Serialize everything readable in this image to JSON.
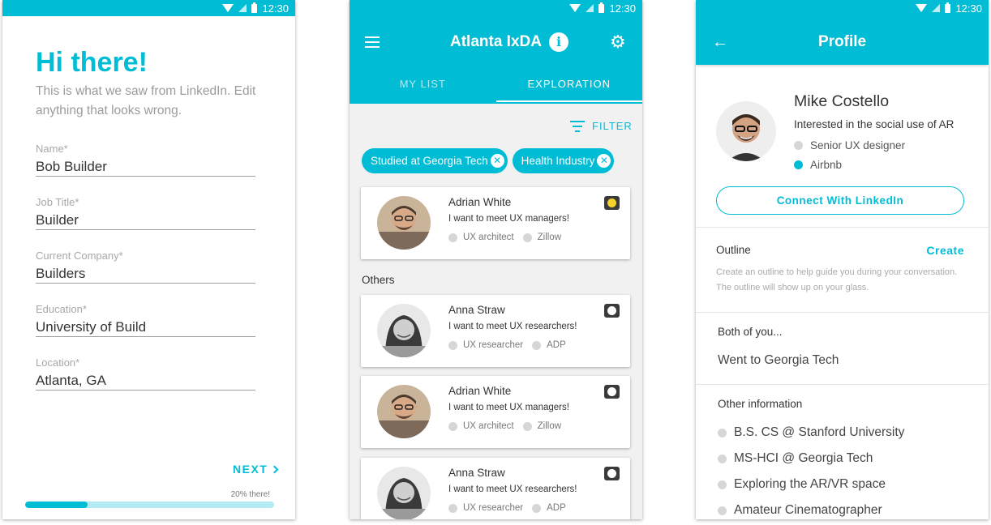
{
  "status": {
    "time": "12:30"
  },
  "colors": {
    "accent": "#00bcd4",
    "status_yellow": "#f7d22a",
    "dot_gray": "#d6d6d6"
  },
  "onboarding": {
    "title": "Hi there!",
    "subtitle": "This is what we saw from LinkedIn. Edit anything that looks wrong.",
    "fields": [
      {
        "label": "Name*",
        "value": "Bob Builder"
      },
      {
        "label": "Job Title*",
        "value": "Builder"
      },
      {
        "label": "Current Company*",
        "value": "Builders"
      },
      {
        "label": "Education*",
        "value": "University of Build"
      },
      {
        "label": "Location*",
        "value": "Atlanta, GA"
      }
    ],
    "next_label": "NEXT",
    "progress_text": "20% there!",
    "progress_fraction": 0.25
  },
  "explore": {
    "app_title": "Atlanta IxDA",
    "info_icon": "info-icon",
    "settings_icon": "gear-icon",
    "tabs": [
      {
        "label": "MY LIST"
      },
      {
        "label": "EXPLORATION"
      }
    ],
    "filter_label": "FILTER",
    "chips": [
      {
        "label": "Studied at Georgia Tech"
      },
      {
        "label": "Health Industry"
      }
    ],
    "others_label": "Others",
    "cards": [
      {
        "name": "Adrian White",
        "message": "I want to meet UX managers!",
        "role": "UX architect",
        "company": "Zillow",
        "status": "yellow"
      },
      {
        "name": "Anna Straw",
        "message": "I want to meet UX researchers!",
        "role": "UX researcher",
        "company": "ADP",
        "status": "white"
      },
      {
        "name": "Adrian White",
        "message": "I want to meet UX managers!",
        "role": "UX architect",
        "company": "Zillow",
        "status": "white"
      },
      {
        "name": "Anna Straw",
        "message": "I want to meet UX researchers!",
        "role": "UX researcher",
        "company": "ADP",
        "status": "white"
      }
    ]
  },
  "profile": {
    "title": "Profile",
    "name": "Mike Costello",
    "interest": "Interested in the social use of AR",
    "role": "Senior UX designer",
    "company": "Airbnb",
    "connect_label": "Connect With LinkedIn",
    "outline": {
      "label": "Outline",
      "action": "Create",
      "description": "Create an outline to help guide you during your conversation. The outline will show up on your glass."
    },
    "both": {
      "title": "Both of you...",
      "text": "Went to Georgia Tech"
    },
    "other": {
      "title": "Other information",
      "items": [
        "B.S. CS @ Stanford University",
        "MS-HCI @ Georgia Tech",
        "Exploring the AR/VR space",
        "Amateur Cinematographer"
      ]
    }
  }
}
